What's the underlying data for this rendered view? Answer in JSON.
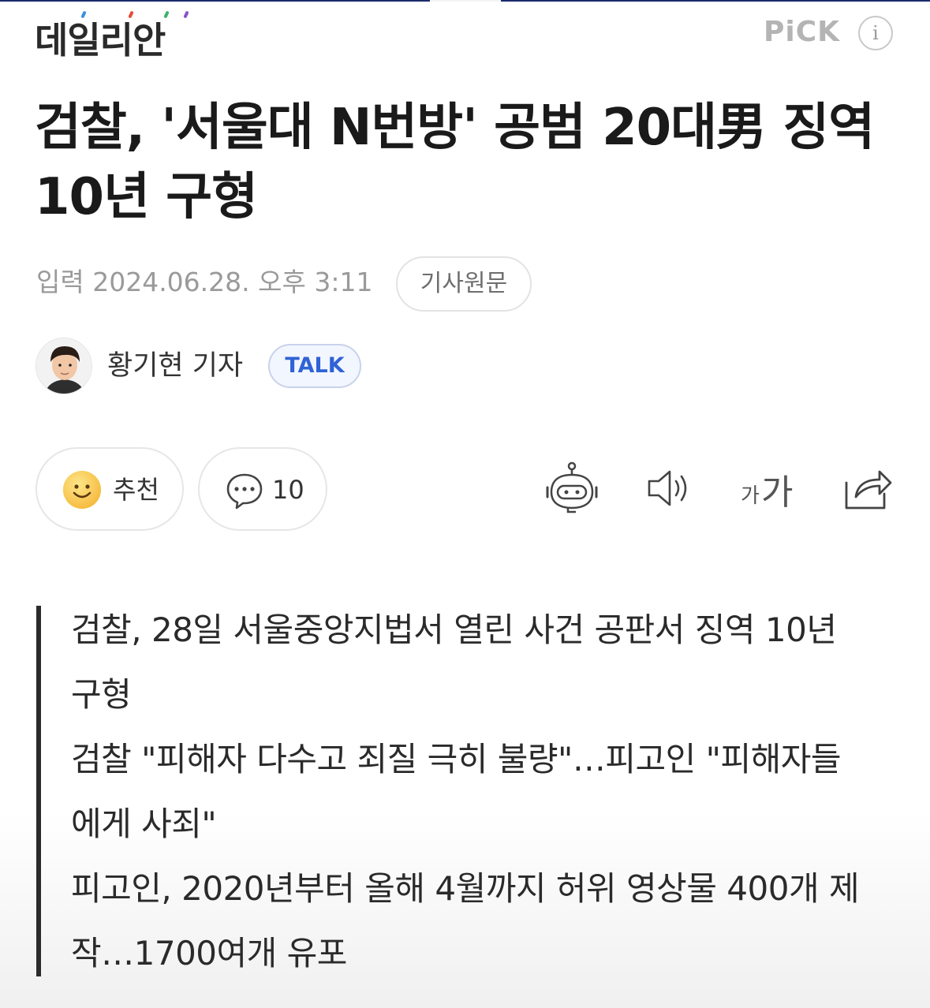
{
  "header": {
    "logo": "데일리안",
    "pick_label": "PiCK",
    "info_label": "i"
  },
  "article": {
    "title": "검찰, '서울대 N번방' 공범 20대男 징역 10년 구형",
    "date": "입력 2024.06.28. 오후 3:11",
    "origin_button": "기사원문",
    "reporter": "황기현 기자",
    "talk_button": "TALK"
  },
  "reactions": {
    "like_label": "추천",
    "comment_count": "10"
  },
  "tools": [
    "robot-summary",
    "speaker-tts",
    "font-size",
    "share"
  ],
  "font_size_icon": {
    "small": "가",
    "big": "가"
  },
  "summary": [
    "검찰, 28일 서울중앙지법서 열린 사건 공판서 징역 10년 구형",
    "검찰 \"피해자 다수고 죄질 극히 불량\"…피고인 \"피해자들에게 사죄\"",
    "피고인, 2020년부터 올해 4월까지 허위 영상물 400개 제작…1700여개 유포"
  ],
  "colors": {
    "accent_blue": "#2f63d6",
    "top_line": "#1b2a6b",
    "summary_bar": "#2b2b2b"
  }
}
